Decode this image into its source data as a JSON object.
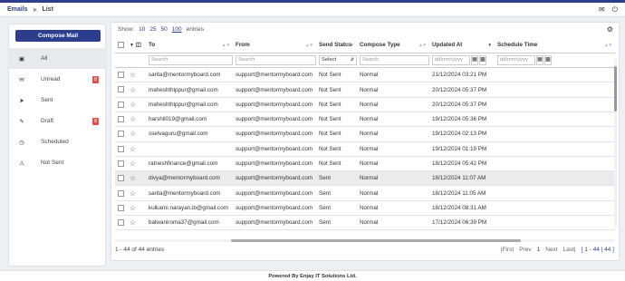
{
  "breadcrumb": {
    "root": "Emails",
    "current": "List"
  },
  "header_icons": {
    "mail": "envelope-icon",
    "power": "power-icon"
  },
  "sidebar": {
    "compose_label": "Compose Mail",
    "items": [
      {
        "key": "all",
        "label": "All",
        "icon": "inbox-icon",
        "active": true
      },
      {
        "key": "unread",
        "label": "Unread",
        "icon": "envelope-icon",
        "badge": "8"
      },
      {
        "key": "sent",
        "label": "Sent",
        "icon": "send-icon"
      },
      {
        "key": "draft",
        "label": "Draft",
        "icon": "draft-icon",
        "badge": "8"
      },
      {
        "key": "scheduled",
        "label": "Scheduled",
        "icon": "clock-icon"
      },
      {
        "key": "notsent",
        "label": "Not Sent",
        "icon": "warning-icon"
      }
    ]
  },
  "length_menu": {
    "show": "Show:",
    "options": [
      "10",
      "25",
      "50",
      "100"
    ],
    "selected": "100",
    "entries": "entries"
  },
  "columns": [
    "To",
    "From",
    "Send Status",
    "Compose Type",
    "Updated At",
    "Schedule Time"
  ],
  "filters": {
    "to_placeholder": "Search",
    "from_placeholder": "Search",
    "status_value": "Select",
    "type_placeholder": "Search",
    "updated_placeholder": "dd/mm/yyyy",
    "schedule_placeholder": "dd/mm/yyyy"
  },
  "rows": [
    {
      "to": "sarita@mentormyboard.com",
      "from": "support@mentormyboard.com",
      "status": "Not Sent",
      "type": "Normal",
      "updated": "21/12/2024 03:21 PM",
      "schedule": ""
    },
    {
      "to": "maheshthippur@gmail.com",
      "from": "support@mentormyboard.com",
      "status": "Not Sent",
      "type": "Normal",
      "updated": "20/12/2024 05:37 PM",
      "schedule": ""
    },
    {
      "to": "maheshthippur@gmail.com",
      "from": "support@mentormyboard.com",
      "status": "Not Sent",
      "type": "Normal",
      "updated": "20/12/2024 05:37 PM",
      "schedule": ""
    },
    {
      "to": "harshil019@gmail.com",
      "from": "support@mentormyboard.com",
      "status": "Not Sent",
      "type": "Normal",
      "updated": "19/12/2024 05:36 PM",
      "schedule": ""
    },
    {
      "to": "sselvaguru@gmail.com",
      "from": "support@mentormyboard.com",
      "status": "Not Sent",
      "type": "Normal",
      "updated": "19/12/2024 02:13 PM",
      "schedule": ""
    },
    {
      "to": "",
      "from": "support@mentormyboard.com",
      "status": "Not Sent",
      "type": "Normal",
      "updated": "19/12/2024 01:19 PM",
      "schedule": ""
    },
    {
      "to": "ratneshfinance@gmail.com",
      "from": "support@mentormyboard.com",
      "status": "Not Sent",
      "type": "Normal",
      "updated": "18/12/2024 05:42 PM",
      "schedule": ""
    },
    {
      "to": "divya@mentormyboard.com",
      "from": "support@mentormyboard.com",
      "status": "Sent",
      "type": "Normal",
      "updated": "18/12/2024 11:07 AM",
      "schedule": "",
      "highlight": true
    },
    {
      "to": "sarita@mentormyboard.com",
      "from": "support@mentormyboard.com",
      "status": "Sent",
      "type": "Normal",
      "updated": "18/12/2024 11:05 AM",
      "schedule": ""
    },
    {
      "to": "kulkarni.narayan.ib@gmail.com",
      "from": "support@mentormyboard.com",
      "status": "Sent",
      "type": "Normal",
      "updated": "18/12/2024 08:31 AM",
      "schedule": ""
    },
    {
      "to": "balwaniroma37@gmail.com",
      "from": "support@mentormyboard.com",
      "status": "Sent",
      "type": "Normal",
      "updated": "17/12/2024 06:39 PM",
      "schedule": ""
    }
  ],
  "info": "1 - 44 of 44 entries",
  "pager": {
    "first": "First",
    "prev": "Prev",
    "page": "1",
    "next": "Next",
    "last": "Last",
    "total": "1 - 44 | 44"
  },
  "footer": "Powered By Enjay IT Solutions Ltd."
}
